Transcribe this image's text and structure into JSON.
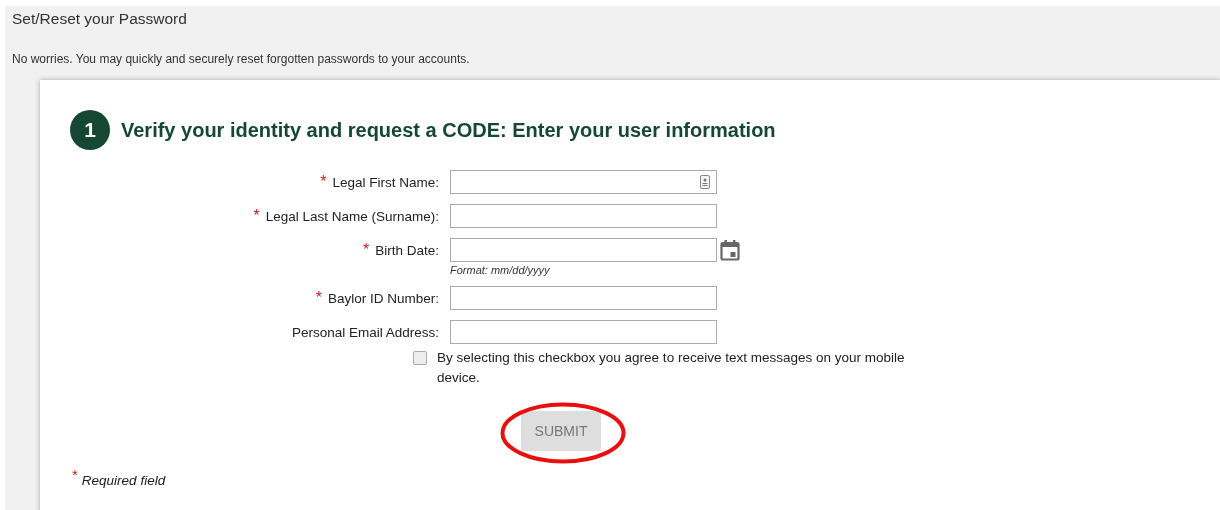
{
  "page": {
    "title": "Set/Reset your Password",
    "subtitle": "No worries. You may quickly and securely reset forgotten passwords to your accounts."
  },
  "step": {
    "number": "1",
    "heading": "Verify your identity and request a CODE: Enter your user information"
  },
  "required_mark": "*",
  "fields": [
    {
      "label": "Legal First Name:",
      "required": true,
      "kind": "contact"
    },
    {
      "label": "Legal Last Name (Surname):",
      "required": true,
      "kind": "text"
    },
    {
      "label": "Birth Date:",
      "required": true,
      "kind": "date",
      "hint": "Format: mm/dd/yyyy"
    },
    {
      "label": "Baylor ID Number:",
      "required": true,
      "kind": "text"
    },
    {
      "label": "Personal Email Address:",
      "required": false,
      "kind": "text"
    }
  ],
  "consent": {
    "label": "By selecting this checkbox you agree to receive text messages on your mobile device.",
    "checked": false
  },
  "submit": {
    "label": "SUBMIT",
    "disabled": true
  },
  "footnote": "Required field"
}
